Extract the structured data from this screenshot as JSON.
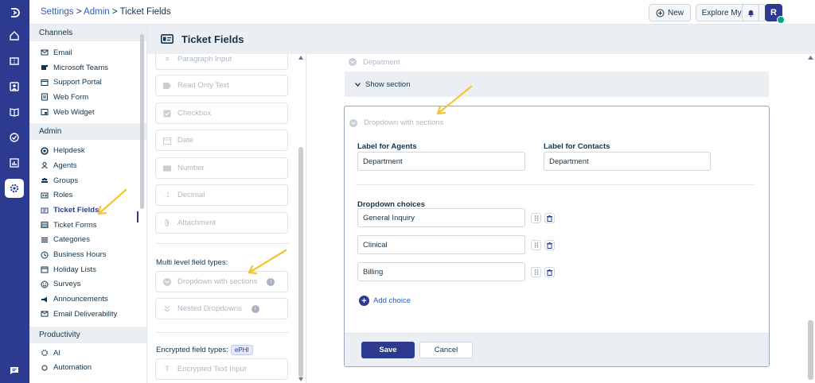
{
  "breadcrumb": {
    "part1": "Settings",
    "sep1": " > ",
    "part2": "Admin",
    "sep2": " > ",
    "current": "Ticket Fields"
  },
  "topbar": {
    "new_label": "New",
    "explore_label": "Explore My Plan",
    "avatar_initial": "R"
  },
  "page_title": "Ticket Fields",
  "sidebar": {
    "sections": [
      {
        "title": "Channels",
        "items": [
          "Email",
          "Microsoft Teams",
          "Support Portal",
          "Web Form",
          "Web Widget"
        ]
      },
      {
        "title": "Admin",
        "items": [
          "Helpdesk",
          "Agents",
          "Groups",
          "Roles",
          "Ticket Fields",
          "Ticket Forms",
          "Categories",
          "Business Hours",
          "Holiday Lists",
          "Surveys",
          "Announcements",
          "Email Deliverability"
        ]
      },
      {
        "title": "Productivity",
        "items": [
          "AI",
          "Automation"
        ]
      }
    ],
    "active_item": "Ticket Fields"
  },
  "field_types": {
    "basic": [
      "Paragraph Input",
      "Read Only Text",
      "Checkbox",
      "Date",
      "Number",
      "Decimal",
      "Attachment"
    ],
    "multi_level_label": "Multi level field types:",
    "multi_level": [
      "Dropdown with sections",
      "Nested Dropdowns"
    ],
    "encrypted_label": "Encrypted field types:",
    "encrypted_badge": "ePHI",
    "encrypted": [
      "Encrypted Text Input"
    ]
  },
  "main": {
    "prev_field": "Depatment",
    "show_section": "Show section",
    "panel_title": "Dropdown with sections",
    "label_agents": "Label for Agents",
    "label_agents_value": "Department",
    "label_contacts": "Label for Contacts",
    "label_contacts_value": "Department",
    "choices_label": "Dropdown choices",
    "choices": [
      "General Inquiry",
      "Clinical",
      "Billing"
    ],
    "add_choice": "Add choice",
    "save": "Save",
    "cancel": "Cancel"
  },
  "colors": {
    "brand": "#2c3b8f",
    "link": "#2c5cc5",
    "panel_bg": "#ebeff3",
    "annotation_arrow": "#f5c431"
  }
}
